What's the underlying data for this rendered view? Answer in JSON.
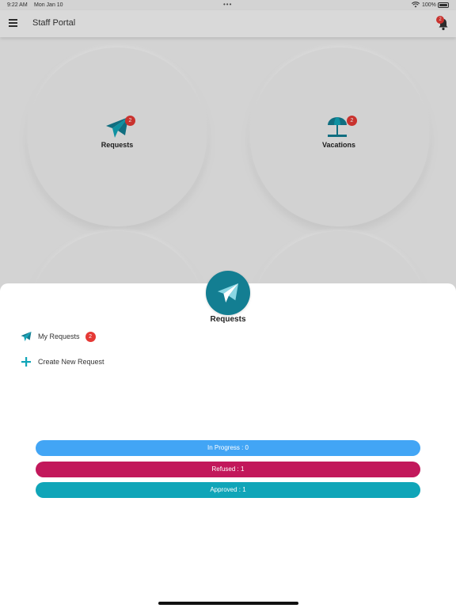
{
  "status_bar": {
    "time": "9:22 AM",
    "date": "Mon Jan 10",
    "battery": "100%"
  },
  "navbar": {
    "title": "Staff Portal",
    "notification_count": "2"
  },
  "tiles": [
    {
      "label": "Requests",
      "badge": "2",
      "icon": "paper-plane-icon"
    },
    {
      "label": "Vacations",
      "badge": "2",
      "icon": "beach-umbrella-icon"
    }
  ],
  "sheet": {
    "title": "Requests",
    "icon": "paper-plane-icon",
    "items": [
      {
        "label": "My Requests",
        "badge": "2",
        "icon": "paper-plane-icon"
      },
      {
        "label": "Create New Request",
        "icon": "plus-icon"
      }
    ],
    "status_pills": [
      {
        "label": "In Progress : 0",
        "color": "#42a5f5"
      },
      {
        "label": "Refused : 1",
        "color": "#c2185b"
      },
      {
        "label": "Approved : 1",
        "color": "#10a5b8"
      }
    ]
  },
  "colors": {
    "accent": "#137e92",
    "badge": "#e53935"
  }
}
